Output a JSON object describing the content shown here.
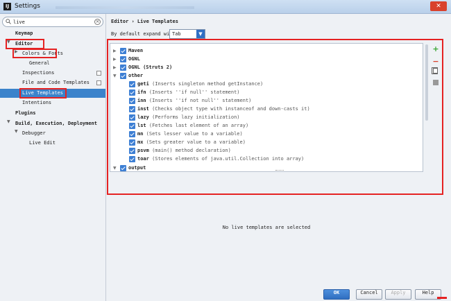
{
  "window": {
    "title": "Settings"
  },
  "search": {
    "value": "live"
  },
  "tree": [
    {
      "label": "Keymap"
    },
    {
      "label": "Editor"
    },
    {
      "label": "Colors & Fonts"
    },
    {
      "label": "General"
    },
    {
      "label": "Inspections"
    },
    {
      "label": "File and Code Templates"
    },
    {
      "label": "Live Templates"
    },
    {
      "label": "Intentions"
    },
    {
      "label": "Plugins"
    },
    {
      "label": "Build, Execution, Deployment"
    },
    {
      "label": "Debugger"
    },
    {
      "label": "Live Edit"
    }
  ],
  "header": {
    "breadcrumb": "Editor › Live Templates"
  },
  "expand": {
    "label": "By default expand with",
    "value": "Tab"
  },
  "templates": {
    "groups": [
      {
        "name": "Maven"
      },
      {
        "name": "OGNL"
      },
      {
        "name": "OGNL (Struts 2)"
      },
      {
        "name": "other"
      }
    ],
    "other_items": [
      {
        "abbr": "geti",
        "desc": "(Inserts singleton method getInstance)"
      },
      {
        "abbr": "ifn",
        "desc": "(Inserts ''if null'' statement)"
      },
      {
        "abbr": "inn",
        "desc": "(Inserts ''if not null'' statement)"
      },
      {
        "abbr": "inst",
        "desc": "(Checks object type with instanceof and down-casts it)"
      },
      {
        "abbr": "lazy",
        "desc": "(Performs lazy initialization)"
      },
      {
        "abbr": "lst",
        "desc": "(Fetches last element of an array)"
      },
      {
        "abbr": "mn",
        "desc": "(Sets lesser value to a variable)"
      },
      {
        "abbr": "mx",
        "desc": "(Sets greater value to a variable)"
      },
      {
        "abbr": "psvm",
        "desc": "(main() method declaration)"
      },
      {
        "abbr": "toar",
        "desc": "(Stores elements of java.util.Collection into array)"
      }
    ],
    "next_group": "output"
  },
  "empty_message": "No live templates are selected",
  "buttons": {
    "ok": "OK",
    "cancel": "Cancel",
    "apply": "Apply",
    "help": "Help"
  },
  "colors": {
    "selection": "#3b83cb",
    "highlight": "#e52222",
    "checkbox": "#3d7fd4"
  }
}
